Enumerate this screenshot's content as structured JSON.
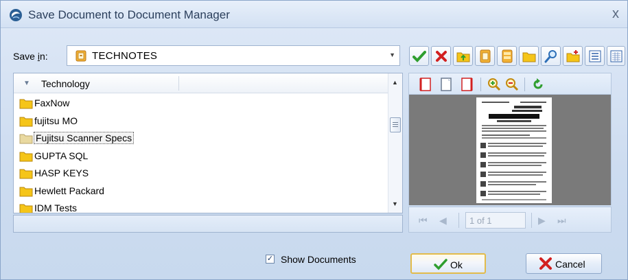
{
  "window": {
    "title": "Save Document to Document Manager",
    "close_glyph": "x"
  },
  "save_in": {
    "label_prefix": "Save ",
    "label_underlined": "i",
    "label_suffix": "n:",
    "value": "TECHNOTES",
    "icon": "cabinet-icon"
  },
  "toolbar": {
    "icons": [
      "check-icon",
      "delete-icon",
      "folder-up-icon",
      "cabinet-icon",
      "cabinet-open-icon",
      "folder-icon",
      "search-icon",
      "new-folder-icon",
      "list-view-icon",
      "details-view-icon"
    ]
  },
  "tree": {
    "column_header": "Technology",
    "items": [
      {
        "label": "FaxNow"
      },
      {
        "label": "fujitsu MO"
      },
      {
        "label": "Fujitsu Scanner Specs"
      },
      {
        "label": "GUPTA SQL"
      },
      {
        "label": "HASP KEYS"
      },
      {
        "label": "Hewlett Packard"
      },
      {
        "label": "IDM Tests"
      }
    ],
    "selected_index": 2
  },
  "preview": {
    "tools": [
      "page-icon",
      "page-blank-icon",
      "page-red-icon",
      "zoom-in-icon",
      "zoom-out-icon",
      "rotate-icon"
    ],
    "page_indicator": "1 of 1"
  },
  "show_documents": {
    "label": "Show Documents",
    "checked": true,
    "check_glyph": "✓"
  },
  "buttons": {
    "ok": "Ok",
    "cancel": "Cancel"
  },
  "colors": {
    "accent_green": "#2f9e2f",
    "accent_red": "#d22020",
    "folder_yellow": "#f5c518"
  }
}
